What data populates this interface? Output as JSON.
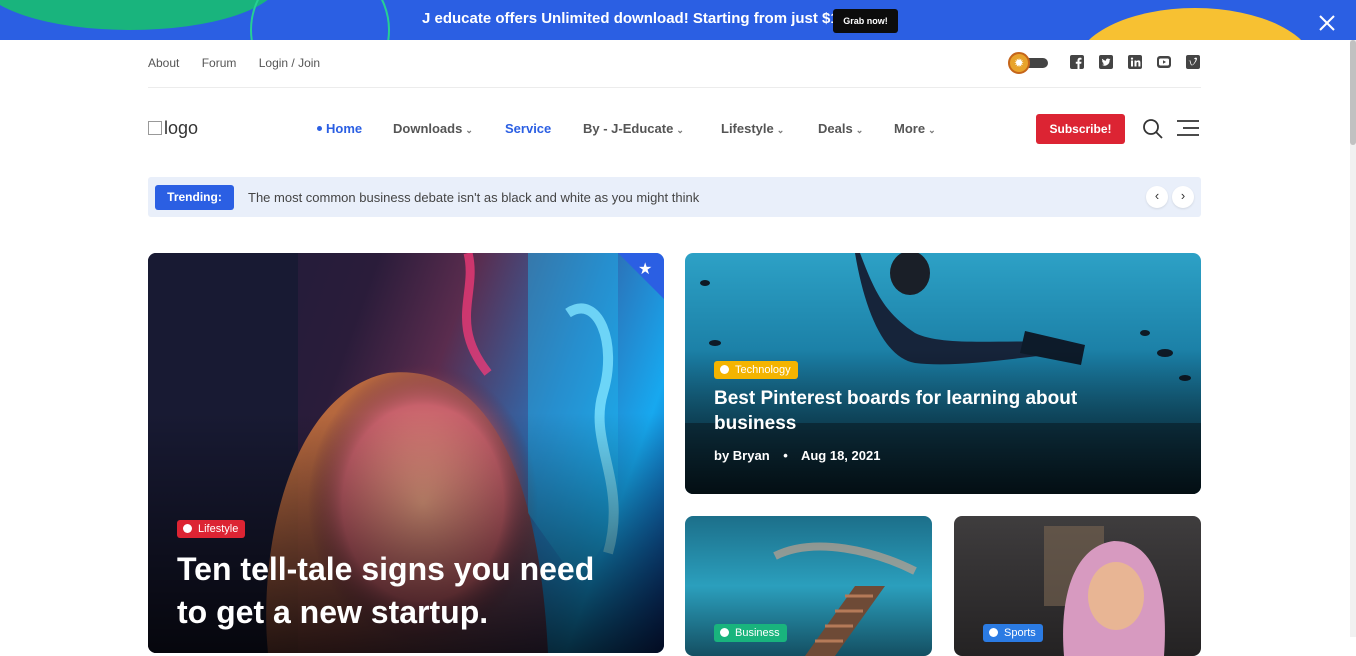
{
  "promo": {
    "text": "J educate offers Unlimited download! Starting from just $15/m",
    "button": "Grab now!",
    "bg": "#2b5fe3"
  },
  "toplinks": [
    "About",
    "Forum",
    "Login / Join"
  ],
  "social": [
    "facebook-icon",
    "twitter-icon",
    "linkedin-icon",
    "youtube-icon",
    "vimeo-icon"
  ],
  "logo": {
    "alt": "logo"
  },
  "nav": [
    {
      "label": "Home",
      "active": true,
      "dropdown": false
    },
    {
      "label": "Downloads",
      "dropdown": true
    },
    {
      "label": "Service",
      "active": true,
      "dropdown": false
    },
    {
      "label": "By - J-Educate",
      "dropdown": true
    },
    {
      "label": "Lifestyle",
      "dropdown": true
    },
    {
      "label": "Deals",
      "dropdown": true
    },
    {
      "label": "More",
      "dropdown": true
    }
  ],
  "subscribe": "Subscribe!",
  "trending": {
    "label": "Trending:",
    "text": "The most common business debate isn't as black and white as you might think"
  },
  "cards": {
    "main": {
      "tag": "Lifestyle",
      "tag_color": "#dc2433",
      "title_line1": "Ten tell-tale signs you need",
      "title_line2": "to get a new startup."
    },
    "right_top": {
      "tag": "Technology",
      "tag_color": "#f4b400",
      "title_line1": "Best Pinterest boards for learning about",
      "title_line2": "business",
      "author": "by Bryan",
      "sep": "•",
      "date": "Aug 18, 2021"
    },
    "bottom_left": {
      "tag": "Business",
      "tag_color": "#19b47d"
    },
    "bottom_right": {
      "tag": "Sports",
      "tag_color": "#2b7be3"
    }
  },
  "colors": {
    "accent": "#2b5fe3",
    "danger": "#dc2433"
  }
}
